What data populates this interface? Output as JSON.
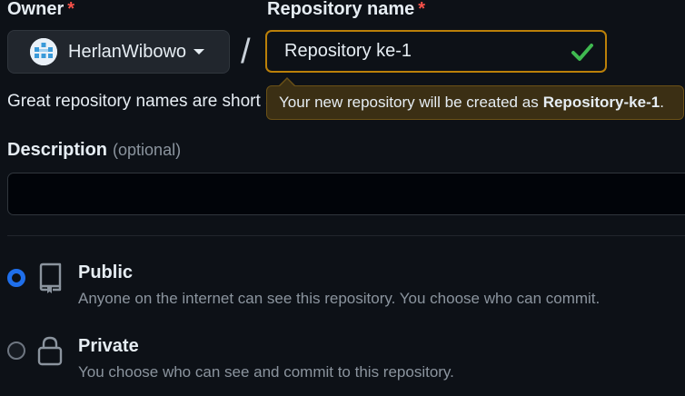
{
  "owner": {
    "label": "Owner",
    "required_mark": "*",
    "name": "HerlanWibowo",
    "avatar_icon": "identicon-avatar"
  },
  "separator": "/",
  "repository": {
    "label": "Repository name",
    "required_mark": "*",
    "value": "Repository ke-1",
    "valid_icon": "check-icon"
  },
  "hint_text": "Great repository names are short and memorable.",
  "tooltip": {
    "prefix": "Your new repository will be created as",
    "name": "Repository-ke-1",
    "suffix": "."
  },
  "description": {
    "label": "Description",
    "optional": "(optional)",
    "value": ""
  },
  "visibility": {
    "options": [
      {
        "title": "Public",
        "description": "Anyone on the internet can see this repository. You choose who can commit.",
        "icon": "repo-icon",
        "selected": true
      },
      {
        "title": "Private",
        "description": "You choose who can see and commit to this repository.",
        "icon": "lock-icon",
        "selected": false
      }
    ]
  },
  "colors": {
    "background": "#0d1117",
    "accent": "#1f6feb",
    "warning_border": "#bb8009",
    "success": "#3fb950",
    "required": "#f85149"
  }
}
